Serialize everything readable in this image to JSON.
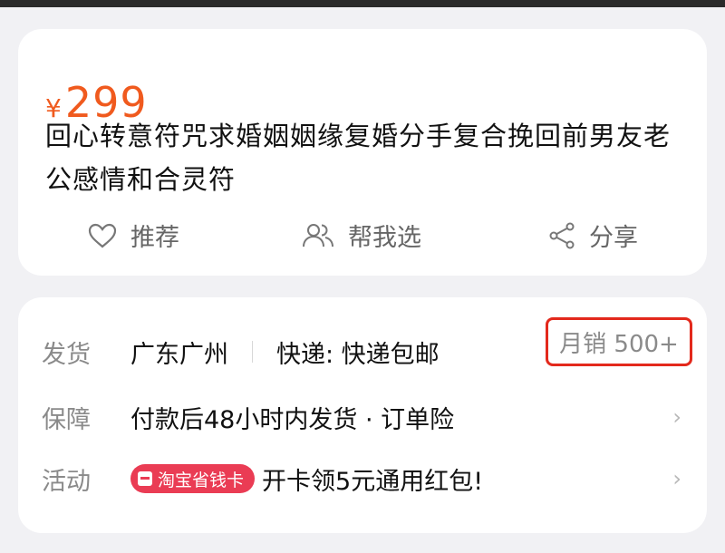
{
  "product": {
    "currency": "¥",
    "price": "299",
    "title": "回心转意符咒求婚姻姻缘复婚分手复合挽回前男友老公感情和合灵符"
  },
  "actions": {
    "recommend": "推荐",
    "help_choose": "帮我选",
    "share": "分享"
  },
  "info": {
    "shipping": {
      "label": "发货",
      "location": "广东广州",
      "method": "快递: 快递包邮",
      "monthly_sales": "月销 500+"
    },
    "guarantee": {
      "label": "保障",
      "value": "付款后48小时内发货 · 订单险"
    },
    "activity": {
      "label": "活动",
      "badge": "淘宝省钱卡",
      "value": "开卡领5元通用红包!"
    }
  },
  "colors": {
    "price": "#f05a1e",
    "badge": "#ea3c54",
    "highlight_box": "#e3291c"
  }
}
